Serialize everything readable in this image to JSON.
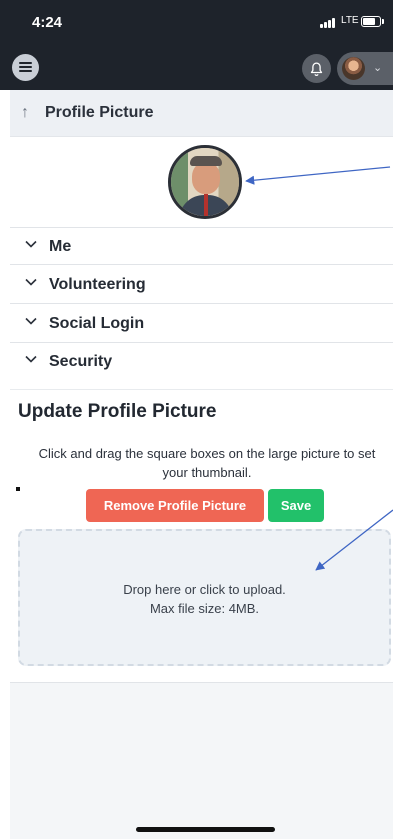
{
  "status_bar": {
    "time": "4:24",
    "network": "LTE"
  },
  "breadcrumb": {
    "title": "Profile Picture"
  },
  "accordion": [
    {
      "label": "Me"
    },
    {
      "label": "Volunteering"
    },
    {
      "label": "Social Login"
    },
    {
      "label": "Security"
    }
  ],
  "update_section": {
    "title": "Update Profile Picture",
    "instructions": "Click and drag the square boxes on the large picture to set your thumbnail.",
    "remove_label": "Remove Profile Picture",
    "save_label": "Save"
  },
  "dropzone": {
    "line1": "Drop here or click to upload.",
    "line2": "Max file size: 4MB."
  },
  "colors": {
    "navbar": "#1e232b",
    "remove_button": "#ef6654",
    "save_button": "#22c16a",
    "annotation_arrow": "#3f66c4"
  }
}
